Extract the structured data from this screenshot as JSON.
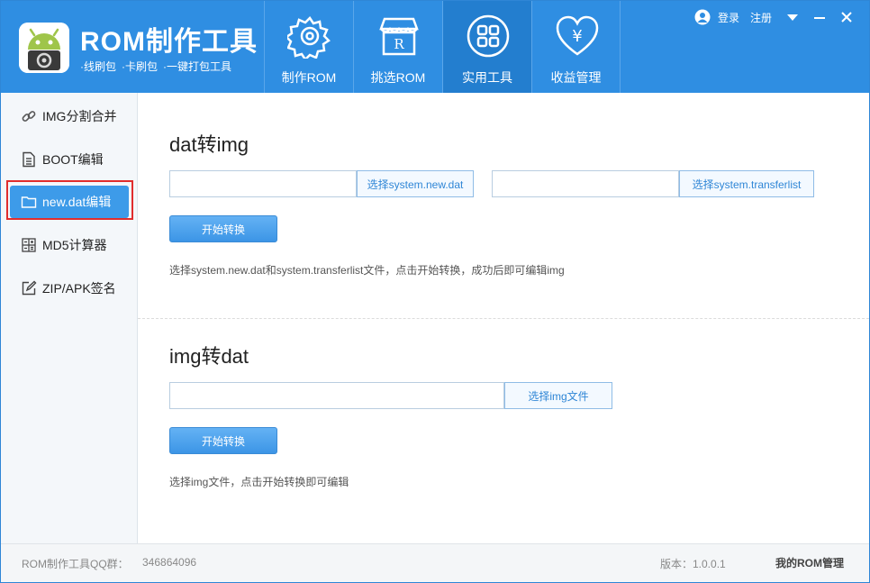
{
  "header": {
    "title": "ROM制作工具",
    "subtitle": [
      "·线刷包",
      "·卡刷包",
      "·一键打包工具"
    ],
    "nav": [
      {
        "label": "制作ROM",
        "icon": "gear-icon"
      },
      {
        "label": "挑选ROM",
        "icon": "rom-store-icon"
      },
      {
        "label": "实用工具",
        "icon": "grid-tools-icon"
      },
      {
        "label": "收益管理",
        "icon": "heart-yuan-icon"
      }
    ],
    "active_nav": "实用工具",
    "login": "登录",
    "register": "注册"
  },
  "sidebar": {
    "items": [
      {
        "label": "IMG分割合并",
        "icon": "link-icon"
      },
      {
        "label": "BOOT编辑",
        "icon": "document-icon"
      },
      {
        "label": "new.dat编辑",
        "icon": "folder-icon"
      },
      {
        "label": "MD5计算器",
        "icon": "calculator-icon"
      },
      {
        "label": "ZIP/APK签名",
        "icon": "edit-icon"
      }
    ],
    "active": "new.dat编辑"
  },
  "dat_to_img": {
    "title": "dat转img",
    "input1_value": "",
    "button1": "选择system.new.dat",
    "input2_value": "",
    "button2": "选择system.transferlist",
    "start": "开始转换",
    "hint": "选择system.new.dat和system.transferlist文件，点击开始转换，成功后即可编辑img"
  },
  "img_to_dat": {
    "title": "img转dat",
    "input_value": "",
    "button": "选择img文件",
    "start": "开始转换",
    "hint": "选择img文件，点击开始转换即可编辑"
  },
  "footer": {
    "qq_label": "ROM制作工具QQ群：",
    "qq_number": "346864096",
    "version": "版本：1.0.0.1",
    "brand": "我的ROM管理"
  },
  "colors": {
    "header_bg": "#2f8ee2",
    "accent": "#3d9be9",
    "highlight_outline": "#e02d2d"
  }
}
